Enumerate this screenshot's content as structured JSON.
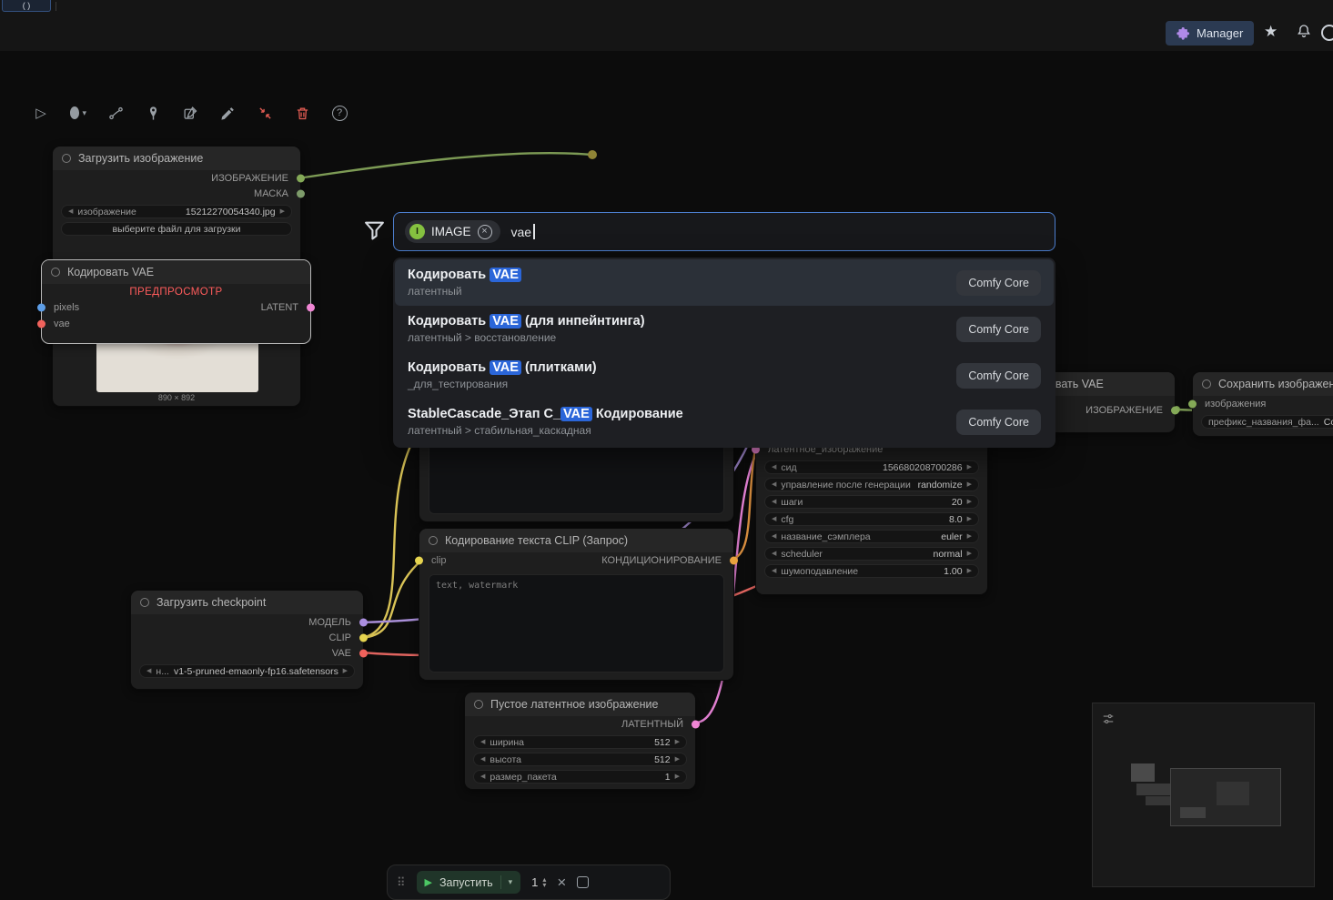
{
  "topbar": {
    "tab": "( )",
    "manager": "Manager"
  },
  "glyphs": {
    "arrow_left": "◀",
    "arrow_right": "▶",
    "chevron_down": "▾",
    "chevron_up": "▴",
    "star": "★",
    "close": "×",
    "help": "?",
    "play_outline": "▷",
    "run_play": "▶",
    "handle": "⠿"
  },
  "search": {
    "chip_letter": "I",
    "chip_label": "IMAGE",
    "query": "vae",
    "results": [
      {
        "pre": "Кодировать ",
        "match": "VAE",
        "post": "",
        "subtitle": "латентный",
        "badge": "Comfy Core"
      },
      {
        "pre": "Кодировать ",
        "match": "VAE",
        "post": " (для инпейнтинга)",
        "subtitle": "латентный > восстановление",
        "badge": "Comfy Core"
      },
      {
        "pre": "Кодировать ",
        "match": "VAE",
        "post": " (плитками)",
        "subtitle": "_для_тестирования",
        "badge": "Comfy Core"
      },
      {
        "pre": "StableCascade_Этап C_",
        "match": "VAE",
        "post": " Кодирование",
        "subtitle": "латентный > стабильная_каскадная",
        "badge": "Comfy Core"
      }
    ]
  },
  "nodes": {
    "load_image": {
      "title": "Загрузить изображение",
      "out1": "ИЗОБРАЖЕНИЕ",
      "out2": "МАСКА",
      "widget_label": "изображение",
      "widget_value": "15212270054340.jpg",
      "upload": "выберите файл для загрузки",
      "size": "890 × 892"
    },
    "vae_encode": {
      "title": "Кодировать VAE",
      "preview": "ПРЕДПРОСМОТР",
      "in1": "pixels",
      "in2": "vae",
      "out": "LATENT"
    },
    "checkpoint": {
      "title": "Загрузить checkpoint",
      "out1": "МОДЕЛЬ",
      "out2": "CLIP",
      "out3": "VAE",
      "widget_label": "н...",
      "widget_value": "v1-5-pruned-emaonly-fp16.safetensors"
    },
    "clip_encode": {
      "title": "Кодирование текста CLIP (Запрос)",
      "in": "clip",
      "out": "КОНДИЦИОНИРОВАНИЕ",
      "text": "text, watermark"
    },
    "empty_latent": {
      "title": "Пустое латентное изображение",
      "out": "ЛАТЕНТНЫЙ",
      "widgets": [
        {
          "label": "ширина",
          "value": "512"
        },
        {
          "label": "высота",
          "value": "512"
        },
        {
          "label": "размер_пакета",
          "value": "1"
        }
      ]
    },
    "ksampler": {
      "in": "латентное_изображение",
      "widgets": [
        {
          "label": "сид",
          "value": "156680208700286"
        },
        {
          "label": "управление после генерации",
          "value": "randomize"
        },
        {
          "label": "шаги",
          "value": "20"
        },
        {
          "label": "cfg",
          "value": "8.0"
        },
        {
          "label": "название_сэмплера",
          "value": "euler"
        },
        {
          "label": "scheduler",
          "value": "normal"
        },
        {
          "label": "шумоподавление",
          "value": "1.00"
        }
      ]
    },
    "vae_decode": {
      "title": "Декодировать VAE",
      "out": "ИЗОБРАЖЕНИЕ"
    },
    "save_image": {
      "title": "Сохранить изображение",
      "in": "изображения",
      "widget_label": "префикс_названия_фа...",
      "widget_value": "Co"
    }
  },
  "queue": {
    "run": "Запустить",
    "count": "1"
  },
  "colors": {
    "accent_blue": "#4d7fd0",
    "match_highlight": "#2b66d9",
    "image_green": "#84a957",
    "latent_pink": "#ef86d4",
    "vae_red": "#f0625c",
    "clip_yellow": "#e6d44f",
    "model_purple": "#ab8fe0",
    "cond_orange": "#e8a33d",
    "danger_red": "#e05b52"
  }
}
